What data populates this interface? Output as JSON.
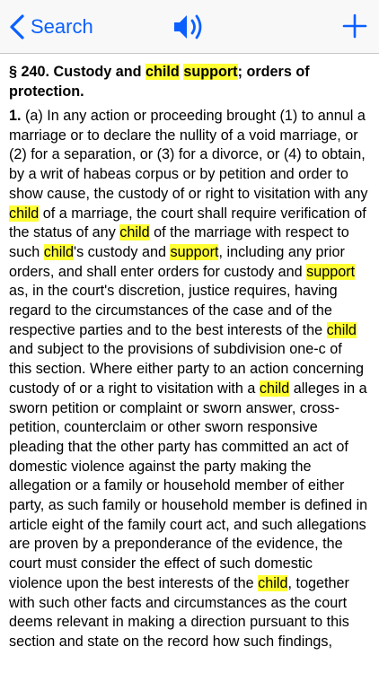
{
  "navbar": {
    "back_label": "Search",
    "back_icon": "chevron-left-icon",
    "speaker_icon": "speaker-icon",
    "add_icon": "plus-icon",
    "accent_color": "#0a60ff"
  },
  "highlight_color": "#ffff33",
  "section": {
    "title_parts": [
      {
        "text": "§ 240. Custody and ",
        "hl": false
      },
      {
        "text": "child",
        "hl": true
      },
      {
        "text": " ",
        "hl": false
      },
      {
        "text": "support",
        "hl": true
      },
      {
        "text": "; orders of protection.",
        "hl": false
      }
    ],
    "paragraph_number": "1.",
    "body_parts": [
      {
        "text": " (a) In any action or proceeding brought (1) to annul a marriage or to declare the nullity of a void marriage, or (2) for a separation, or (3) for a divorce, or (4) to obtain, by a writ of habeas corpus or by petition and order to show cause, the custody of or right to visitation with any ",
        "hl": false
      },
      {
        "text": "child",
        "hl": true
      },
      {
        "text": " of a marriage, the court shall require verification of the status of any ",
        "hl": false
      },
      {
        "text": "child",
        "hl": true
      },
      {
        "text": " of the marriage with respect to such ",
        "hl": false
      },
      {
        "text": "child",
        "hl": true
      },
      {
        "text": "'s custody and ",
        "hl": false
      },
      {
        "text": "support",
        "hl": true
      },
      {
        "text": ", including any prior orders, and shall enter orders for custody and ",
        "hl": false
      },
      {
        "text": "support",
        "hl": true
      },
      {
        "text": " as, in the court's discretion, justice requires, having regard to the circumstances of the case and of the respective parties and to the best interests of the ",
        "hl": false
      },
      {
        "text": "child",
        "hl": true
      },
      {
        "text": " and subject to the provisions of subdivision one-c of this section. Where either party to an action concerning custody of or a right to visitation with a ",
        "hl": false
      },
      {
        "text": "child",
        "hl": true
      },
      {
        "text": " alleges in a sworn petition or complaint or sworn answer, cross-petition, counterclaim or other sworn responsive pleading that the other party has committed an act of domestic violence against the party making the allegation or a family or household member of either party, as such family or household member is defined in article eight of the family court act, and such allegations are proven by a preponderance of the evidence, the court must consider the effect of such domestic violence upon the best interests of the ",
        "hl": false
      },
      {
        "text": "child",
        "hl": true
      },
      {
        "text": ", together with such other facts and circumstances as the court deems relevant in making a direction pursuant to this section and state on the record how such findings,",
        "hl": false
      }
    ]
  }
}
